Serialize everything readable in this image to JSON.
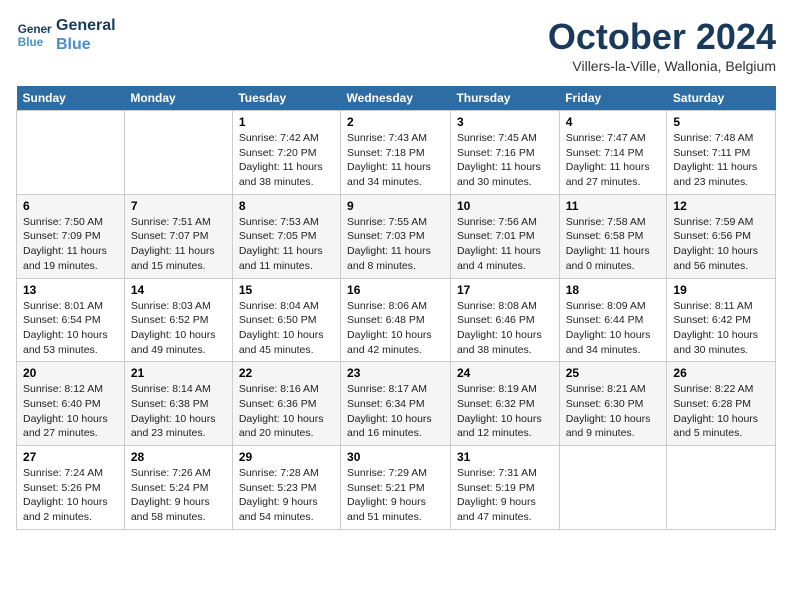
{
  "header": {
    "logo_line1": "General",
    "logo_line2": "Blue",
    "month": "October 2024",
    "location": "Villers-la-Ville, Wallonia, Belgium"
  },
  "days_of_week": [
    "Sunday",
    "Monday",
    "Tuesday",
    "Wednesday",
    "Thursday",
    "Friday",
    "Saturday"
  ],
  "weeks": [
    [
      {
        "day": "",
        "info": ""
      },
      {
        "day": "",
        "info": ""
      },
      {
        "day": "1",
        "info": "Sunrise: 7:42 AM\nSunset: 7:20 PM\nDaylight: 11 hours and 38 minutes."
      },
      {
        "day": "2",
        "info": "Sunrise: 7:43 AM\nSunset: 7:18 PM\nDaylight: 11 hours and 34 minutes."
      },
      {
        "day": "3",
        "info": "Sunrise: 7:45 AM\nSunset: 7:16 PM\nDaylight: 11 hours and 30 minutes."
      },
      {
        "day": "4",
        "info": "Sunrise: 7:47 AM\nSunset: 7:14 PM\nDaylight: 11 hours and 27 minutes."
      },
      {
        "day": "5",
        "info": "Sunrise: 7:48 AM\nSunset: 7:11 PM\nDaylight: 11 hours and 23 minutes."
      }
    ],
    [
      {
        "day": "6",
        "info": "Sunrise: 7:50 AM\nSunset: 7:09 PM\nDaylight: 11 hours and 19 minutes."
      },
      {
        "day": "7",
        "info": "Sunrise: 7:51 AM\nSunset: 7:07 PM\nDaylight: 11 hours and 15 minutes."
      },
      {
        "day": "8",
        "info": "Sunrise: 7:53 AM\nSunset: 7:05 PM\nDaylight: 11 hours and 11 minutes."
      },
      {
        "day": "9",
        "info": "Sunrise: 7:55 AM\nSunset: 7:03 PM\nDaylight: 11 hours and 8 minutes."
      },
      {
        "day": "10",
        "info": "Sunrise: 7:56 AM\nSunset: 7:01 PM\nDaylight: 11 hours and 4 minutes."
      },
      {
        "day": "11",
        "info": "Sunrise: 7:58 AM\nSunset: 6:58 PM\nDaylight: 11 hours and 0 minutes."
      },
      {
        "day": "12",
        "info": "Sunrise: 7:59 AM\nSunset: 6:56 PM\nDaylight: 10 hours and 56 minutes."
      }
    ],
    [
      {
        "day": "13",
        "info": "Sunrise: 8:01 AM\nSunset: 6:54 PM\nDaylight: 10 hours and 53 minutes."
      },
      {
        "day": "14",
        "info": "Sunrise: 8:03 AM\nSunset: 6:52 PM\nDaylight: 10 hours and 49 minutes."
      },
      {
        "day": "15",
        "info": "Sunrise: 8:04 AM\nSunset: 6:50 PM\nDaylight: 10 hours and 45 minutes."
      },
      {
        "day": "16",
        "info": "Sunrise: 8:06 AM\nSunset: 6:48 PM\nDaylight: 10 hours and 42 minutes."
      },
      {
        "day": "17",
        "info": "Sunrise: 8:08 AM\nSunset: 6:46 PM\nDaylight: 10 hours and 38 minutes."
      },
      {
        "day": "18",
        "info": "Sunrise: 8:09 AM\nSunset: 6:44 PM\nDaylight: 10 hours and 34 minutes."
      },
      {
        "day": "19",
        "info": "Sunrise: 8:11 AM\nSunset: 6:42 PM\nDaylight: 10 hours and 30 minutes."
      }
    ],
    [
      {
        "day": "20",
        "info": "Sunrise: 8:12 AM\nSunset: 6:40 PM\nDaylight: 10 hours and 27 minutes."
      },
      {
        "day": "21",
        "info": "Sunrise: 8:14 AM\nSunset: 6:38 PM\nDaylight: 10 hours and 23 minutes."
      },
      {
        "day": "22",
        "info": "Sunrise: 8:16 AM\nSunset: 6:36 PM\nDaylight: 10 hours and 20 minutes."
      },
      {
        "day": "23",
        "info": "Sunrise: 8:17 AM\nSunset: 6:34 PM\nDaylight: 10 hours and 16 minutes."
      },
      {
        "day": "24",
        "info": "Sunrise: 8:19 AM\nSunset: 6:32 PM\nDaylight: 10 hours and 12 minutes."
      },
      {
        "day": "25",
        "info": "Sunrise: 8:21 AM\nSunset: 6:30 PM\nDaylight: 10 hours and 9 minutes."
      },
      {
        "day": "26",
        "info": "Sunrise: 8:22 AM\nSunset: 6:28 PM\nDaylight: 10 hours and 5 minutes."
      }
    ],
    [
      {
        "day": "27",
        "info": "Sunrise: 7:24 AM\nSunset: 5:26 PM\nDaylight: 10 hours and 2 minutes."
      },
      {
        "day": "28",
        "info": "Sunrise: 7:26 AM\nSunset: 5:24 PM\nDaylight: 9 hours and 58 minutes."
      },
      {
        "day": "29",
        "info": "Sunrise: 7:28 AM\nSunset: 5:23 PM\nDaylight: 9 hours and 54 minutes."
      },
      {
        "day": "30",
        "info": "Sunrise: 7:29 AM\nSunset: 5:21 PM\nDaylight: 9 hours and 51 minutes."
      },
      {
        "day": "31",
        "info": "Sunrise: 7:31 AM\nSunset: 5:19 PM\nDaylight: 9 hours and 47 minutes."
      },
      {
        "day": "",
        "info": ""
      },
      {
        "day": "",
        "info": ""
      }
    ]
  ]
}
